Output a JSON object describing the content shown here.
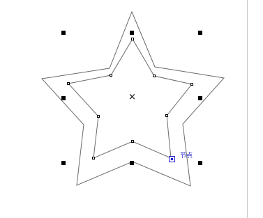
{
  "canvas": {
    "background": "#ffffff",
    "outline_color": "#6a6a6a",
    "handle_color": "#000000",
    "accent_color": "#2020c8",
    "right_edge_color": "#c8c8c8"
  },
  "shape": {
    "type": "star",
    "points": 5,
    "contour": "inner-outline"
  },
  "selection": {
    "center_marker": "×",
    "cursor_icon": "contour-cursor-icon",
    "cursor_hint": "节点"
  }
}
